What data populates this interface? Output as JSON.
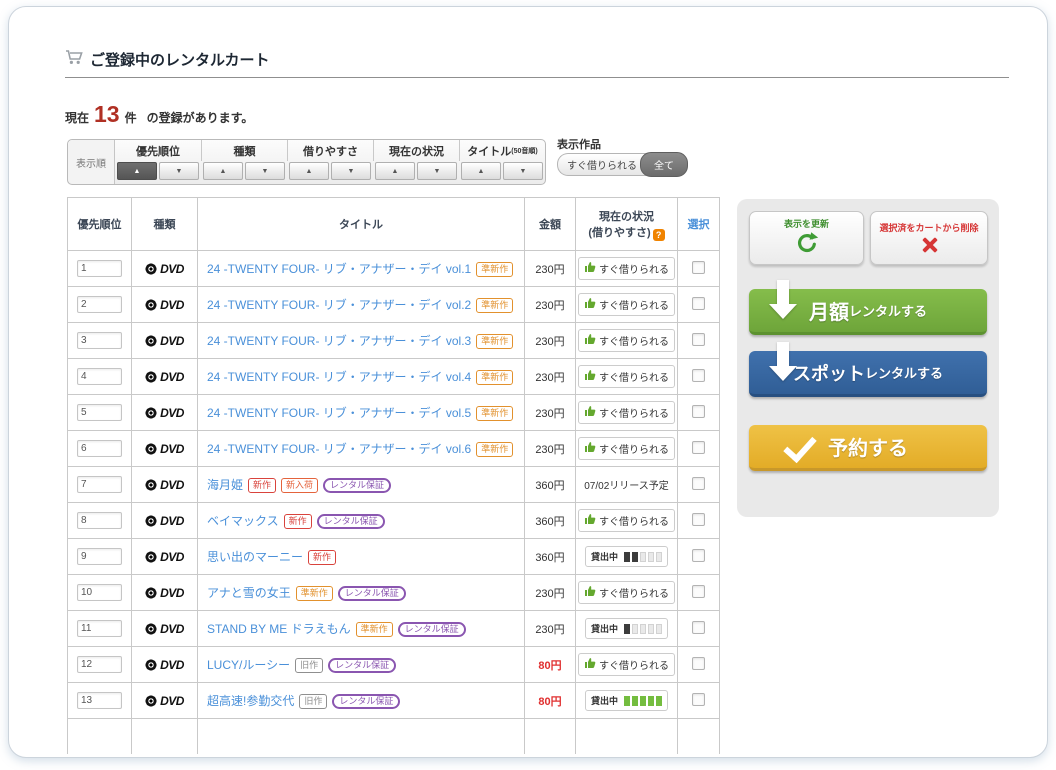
{
  "header": {
    "title": "ご登録中のレンタルカート"
  },
  "summary": {
    "prefix": "現在",
    "count": "13",
    "unit": "件",
    "suffix": "の登録があります。"
  },
  "sort_bar": {
    "label": "表示順",
    "asc_glyph": "▲",
    "desc_glyph": "▼",
    "groups": [
      {
        "label": "優先順位",
        "sub": "",
        "active": "asc"
      },
      {
        "label": "種類",
        "sub": "",
        "active": ""
      },
      {
        "label": "借りやすさ",
        "sub": "",
        "active": ""
      },
      {
        "label": "現在の状況",
        "sub": "",
        "active": ""
      },
      {
        "label": "タイトル",
        "sub": "(50音順)",
        "active": ""
      }
    ]
  },
  "filter": {
    "label": "表示作品",
    "options": [
      {
        "label": "すぐ借りられる",
        "selected": false
      },
      {
        "label": "全て",
        "selected": true
      }
    ]
  },
  "table": {
    "headers": {
      "priority": "優先順位",
      "type": "種類",
      "title": "タイトル",
      "price": "金額",
      "status1": "現在の状況",
      "status2": "(借りやすさ)",
      "select": "選択"
    },
    "type_label": "DVD",
    "badge_colors": {
      "新作": "#d9433c",
      "準新作": "#e2912d",
      "新入荷": "#e4633c",
      "旧作": "#8f8f8f",
      "レンタル保証": "#8a56b0"
    },
    "rows": [
      {
        "priority": "1",
        "title": "24 -TWENTY FOUR- リブ・アナザー・デイ vol.1",
        "badges": [
          "準新作"
        ],
        "price": "230円",
        "price_red": false,
        "status": {
          "kind": "available",
          "text": "すぐ借りられる"
        }
      },
      {
        "priority": "2",
        "title": "24 -TWENTY FOUR- リブ・アナザー・デイ vol.2",
        "badges": [
          "準新作"
        ],
        "price": "230円",
        "price_red": false,
        "status": {
          "kind": "available",
          "text": "すぐ借りられる"
        }
      },
      {
        "priority": "3",
        "title": "24 -TWENTY FOUR- リブ・アナザー・デイ vol.3",
        "badges": [
          "準新作"
        ],
        "price": "230円",
        "price_red": false,
        "status": {
          "kind": "available",
          "text": "すぐ借りられる"
        }
      },
      {
        "priority": "4",
        "title": "24 -TWENTY FOUR- リブ・アナザー・デイ vol.4",
        "badges": [
          "準新作"
        ],
        "price": "230円",
        "price_red": false,
        "status": {
          "kind": "available",
          "text": "すぐ借りられる"
        }
      },
      {
        "priority": "5",
        "title": "24 -TWENTY FOUR- リブ・アナザー・デイ vol.5",
        "badges": [
          "準新作"
        ],
        "price": "230円",
        "price_red": false,
        "status": {
          "kind": "available",
          "text": "すぐ借りられる"
        }
      },
      {
        "priority": "6",
        "title": "24 -TWENTY FOUR- リブ・アナザー・デイ vol.6",
        "badges": [
          "準新作"
        ],
        "price": "230円",
        "price_red": false,
        "status": {
          "kind": "available",
          "text": "すぐ借りられる"
        }
      },
      {
        "priority": "7",
        "title": "海月姫",
        "badges": [
          "新作",
          "新入荷",
          "レンタル保証"
        ],
        "price": "360円",
        "price_red": false,
        "status": {
          "kind": "release",
          "text": "07/02リリース予定"
        }
      },
      {
        "priority": "8",
        "title": "ベイマックス",
        "badges": [
          "新作",
          "レンタル保証"
        ],
        "price": "360円",
        "price_red": false,
        "status": {
          "kind": "available",
          "text": "すぐ借りられる"
        }
      },
      {
        "priority": "9",
        "title": "思い出のマーニー",
        "badges": [
          "新作"
        ],
        "price": "360円",
        "price_red": false,
        "status": {
          "kind": "rented",
          "text": "貸出中",
          "filled": 2,
          "total": 5,
          "fill": "#3c3c3c"
        }
      },
      {
        "priority": "10",
        "title": "アナと雪の女王",
        "badges": [
          "準新作",
          "レンタル保証"
        ],
        "price": "230円",
        "price_red": false,
        "status": {
          "kind": "available",
          "text": "すぐ借りられる"
        }
      },
      {
        "priority": "11",
        "title": "STAND BY ME ドラえもん",
        "badges": [
          "準新作",
          "レンタル保証"
        ],
        "price": "230円",
        "price_red": false,
        "status": {
          "kind": "rented",
          "text": "貸出中",
          "filled": 1,
          "total": 5,
          "fill": "#3c3c3c"
        }
      },
      {
        "priority": "12",
        "title": "LUCY/ルーシー",
        "badges": [
          "旧作",
          "レンタル保証"
        ],
        "price": "80円",
        "price_red": true,
        "status": {
          "kind": "available",
          "text": "すぐ借りられる"
        }
      },
      {
        "priority": "13",
        "title": "超高速!参勤交代",
        "badges": [
          "旧作",
          "レンタル保証"
        ],
        "price": "80円",
        "price_red": true,
        "status": {
          "kind": "rented",
          "text": "貸出中",
          "filled": 5,
          "total": 5,
          "fill": "#74bd3f"
        }
      }
    ]
  },
  "panel": {
    "refresh": "表示を更新",
    "delete": "選択済をカートから削除",
    "monthly": {
      "big": "月額",
      "small": "レンタルする"
    },
    "spot": {
      "big": "スポット",
      "small": "レンタルする"
    },
    "reserve": "予約する"
  },
  "colors": {
    "accent_green": "#79b43c",
    "accent_blue": "#36649e",
    "accent_yellow": "#e9b832",
    "price_red": "#e02f2f",
    "link_blue": "#4a90d9",
    "count_red": "#b03024"
  }
}
